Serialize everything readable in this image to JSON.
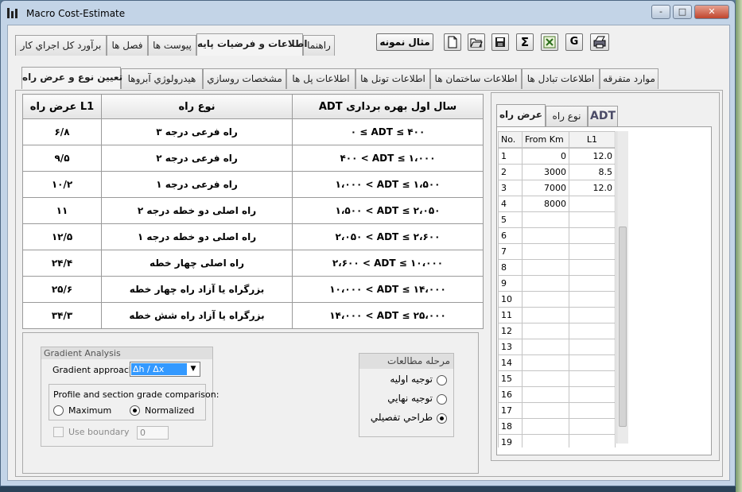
{
  "window": {
    "title": "Macro Cost-Estimate",
    "controls": [
      "-",
      "□",
      "✕"
    ]
  },
  "toolbar": {
    "example_button": "مثال نمونه",
    "buttons": [
      "new-file-icon",
      "open-folder-icon",
      "save-icon",
      "sigma-icon",
      "excel-icon",
      "g-icon",
      "print-icon"
    ],
    "g_label": "G",
    "sigma_label": "Σ"
  },
  "main_tabs": [
    "راهنما",
    "اطلاعات و فرضيات پايه",
    "پيوست ها",
    "فصل ها",
    "برآورد کل اجراي کار"
  ],
  "sub_tabs": [
    "موارد متفرقه",
    "اطلاعات تبادل ها",
    "اطلاعات ساختمان ها",
    "اطلاعات تونل ها",
    "اطلاعات پل ها",
    "مشخصات روسازي",
    "هيدرولوژي آبروها",
    "تعيين نوع و عرض راه"
  ],
  "adt_table": {
    "headers": [
      "ADT سال اول بهره برداری",
      "نوع راه",
      "عرض راه L1"
    ],
    "rows": [
      [
        "۰ ≤ ADT ≤ ۴۰۰",
        "راه فرعی درجه ۳",
        "۶/۸"
      ],
      [
        "۴۰۰ < ADT ≤ ۱،۰۰۰",
        "راه فرعی درجه ۲",
        "۹/۵"
      ],
      [
        "۱،۰۰۰ < ADT ≤ ۱،۵۰۰",
        "راه فرعی درجه ۱",
        "۱۰/۲"
      ],
      [
        "۱،۵۰۰ < ADT ≤ ۲،۰۵۰",
        "راه اصلی دو خطه درجه ۲",
        "۱۱"
      ],
      [
        "۲،۰۵۰ < ADT ≤ ۲،۶۰۰",
        "راه اصلی دو خطه درجه ۱",
        "۱۲/۵"
      ],
      [
        "۲،۶۰۰ < ADT ≤ ۱۰،۰۰۰",
        "راه اصلی چهار خطه",
        "۲۴/۴"
      ],
      [
        "۱۰،۰۰۰ < ADT ≤ ۱۴،۰۰۰",
        "بزرگراه یا آزاد راه چهار خطه",
        "۲۵/۶"
      ],
      [
        "۱۴،۰۰۰ < ADT ≤ ۲۵،۰۰۰",
        "بزرگراه یا آزاد راه شش خطه",
        "۳۴/۳"
      ]
    ]
  },
  "gradient": {
    "title": "Gradient Analysis",
    "approach_label": "Gradient approach:",
    "approach_value": "Δh / Δx",
    "comparison_label": "Profile and section grade comparison:",
    "option_max": "Maximum",
    "option_normalized": "Normalized",
    "selected": "Normalized",
    "use_boundary": "Use boundary",
    "boundary_value": "0"
  },
  "study_phase": {
    "title": "مرحله مطالعات",
    "options": [
      "توجيه اوليه",
      "توجيه نهايي",
      "طراحي تفصيلي"
    ],
    "selected": "طراحي تفصيلي"
  },
  "right_tabs": [
    "ADT",
    "نوع راه",
    "عرض راه"
  ],
  "width_grid": {
    "headers": [
      "No.",
      "From Km",
      "L1"
    ],
    "rows": [
      [
        "1",
        "0",
        "12.0"
      ],
      [
        "2",
        "3000",
        "8.5"
      ],
      [
        "3",
        "7000",
        "12.0"
      ],
      [
        "4",
        "8000",
        ""
      ],
      [
        "5",
        "",
        ""
      ],
      [
        "6",
        "",
        ""
      ],
      [
        "7",
        "",
        ""
      ],
      [
        "8",
        "",
        ""
      ],
      [
        "9",
        "",
        ""
      ],
      [
        "10",
        "",
        ""
      ],
      [
        "11",
        "",
        ""
      ],
      [
        "12",
        "",
        ""
      ],
      [
        "13",
        "",
        ""
      ],
      [
        "14",
        "",
        ""
      ],
      [
        "15",
        "",
        ""
      ],
      [
        "16",
        "",
        ""
      ],
      [
        "17",
        "",
        ""
      ],
      [
        "18",
        "",
        ""
      ],
      [
        "19",
        "",
        ""
      ]
    ]
  }
}
